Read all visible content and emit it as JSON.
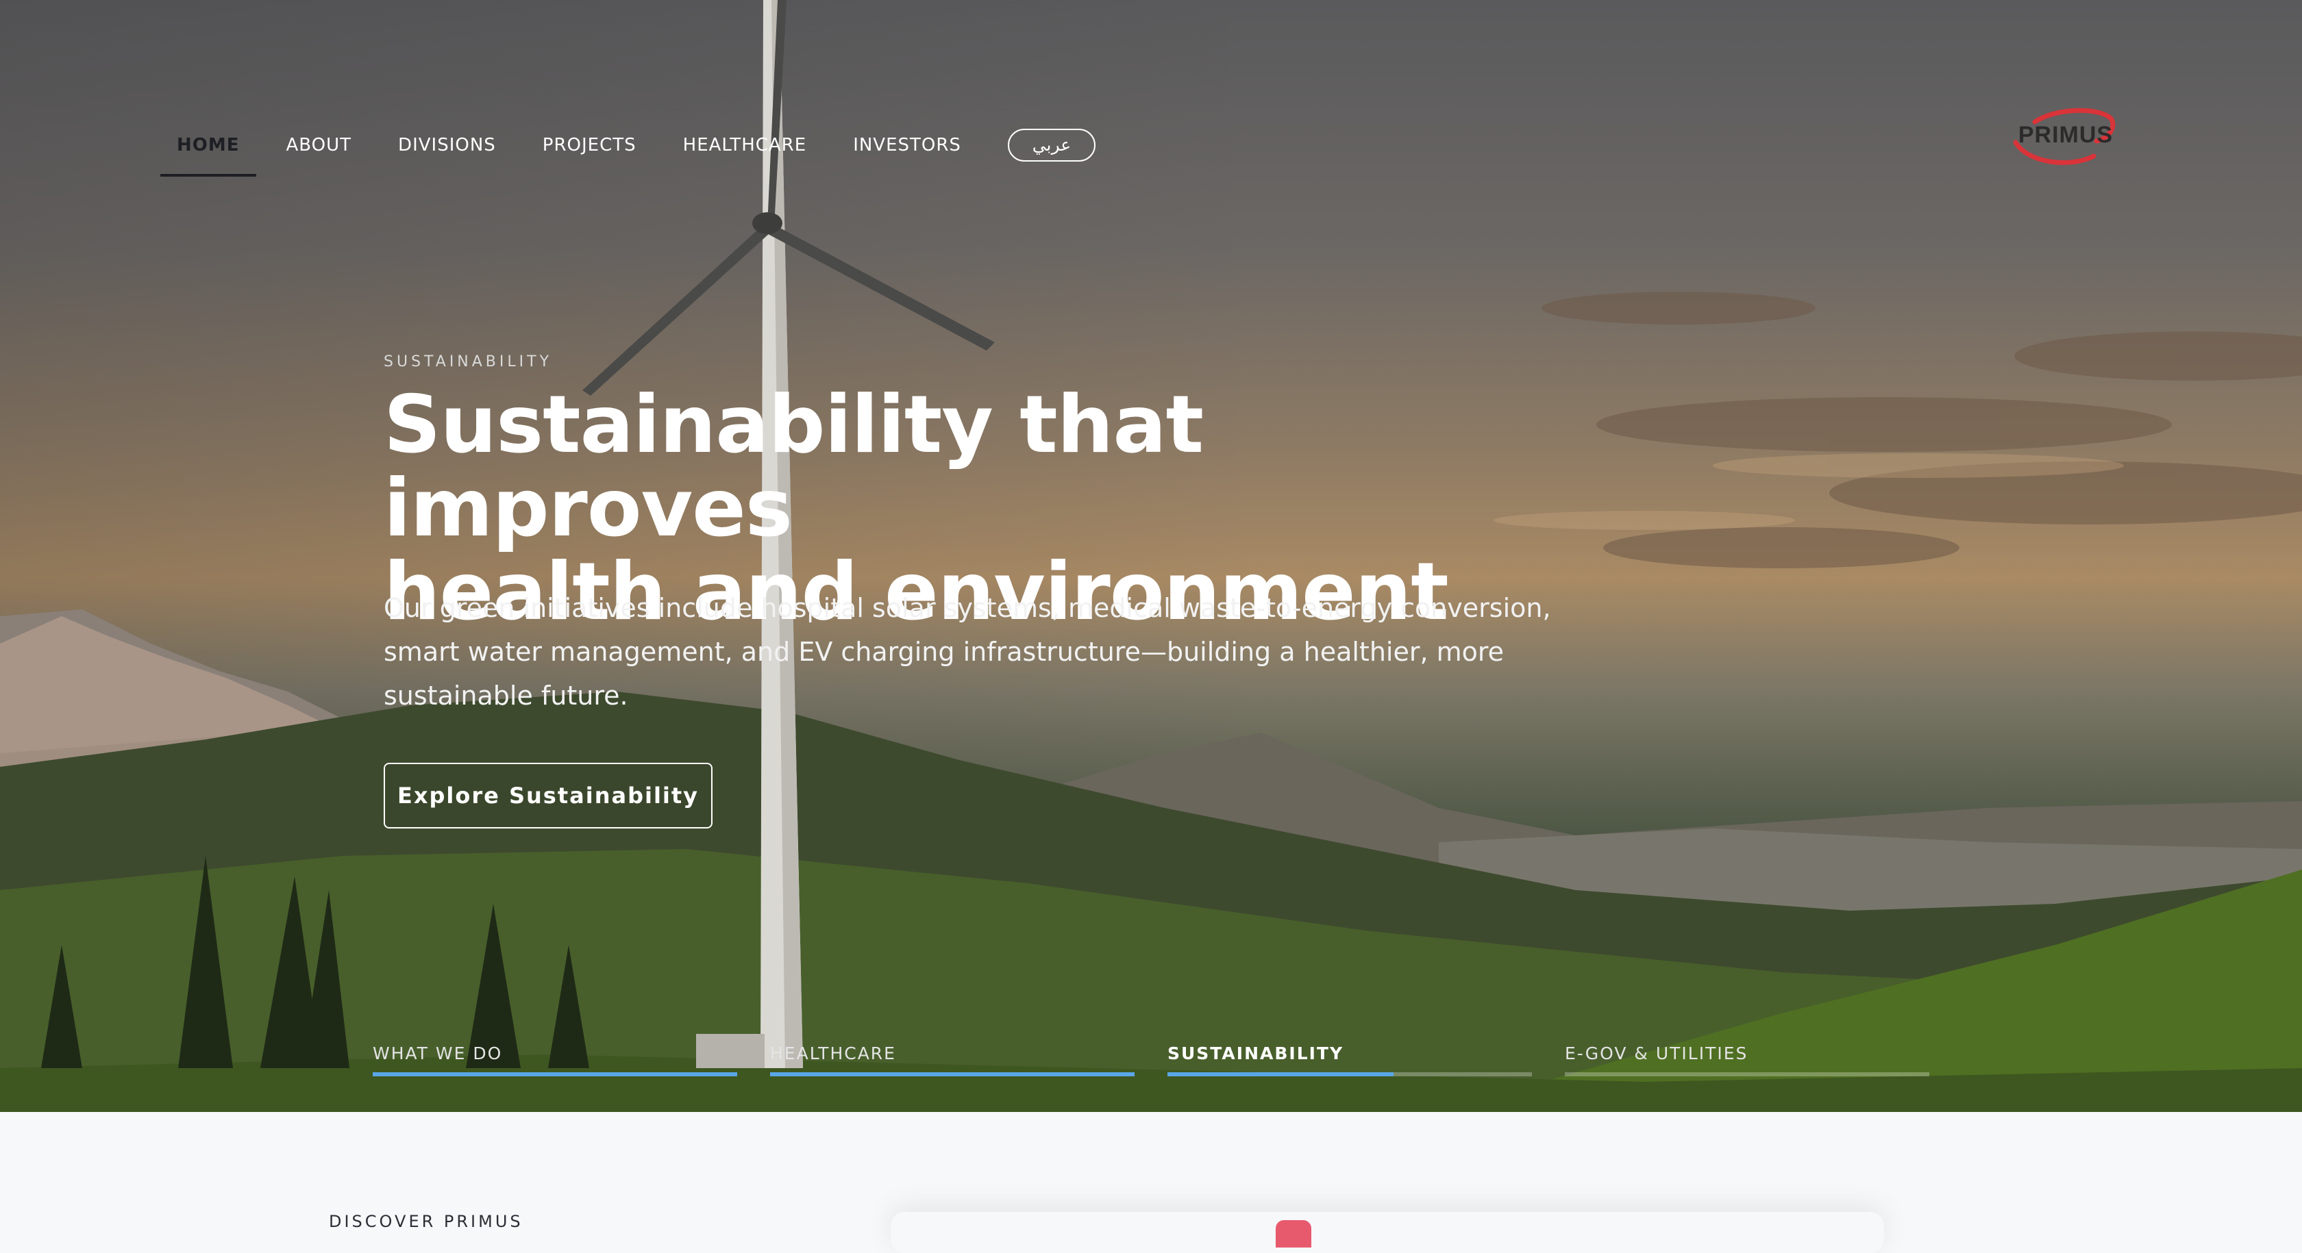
{
  "nav": {
    "items": [
      {
        "label": "HOME",
        "active": true
      },
      {
        "label": "ABOUT",
        "active": false
      },
      {
        "label": "DIVISIONS",
        "active": false
      },
      {
        "label": "PROJECTS",
        "active": false
      },
      {
        "label": "HEALTHCARE",
        "active": false
      },
      {
        "label": "INVESTORS",
        "active": false
      }
    ],
    "lang_label": "عربي"
  },
  "logo": {
    "text": "PRIMUS",
    "accent": "#d9343a",
    "text_color": "#2b2b2b"
  },
  "hero": {
    "eyebrow": "SUSTAINABILITY",
    "title_line1": "Sustainability that improves",
    "title_line2": "health and environment",
    "lead": "Our green initiatives include hospital solar systems, medical waste-to-energy conversion, smart water management, and EV charging infrastructure—building a healthier, more sustainable future.",
    "cta_label": "Explore Sustainability"
  },
  "tabs": [
    {
      "label": "WHAT WE DO",
      "progress": 1.0,
      "active": false
    },
    {
      "label": "HEALTHCARE",
      "progress": 1.0,
      "active": false
    },
    {
      "label": "SUSTAINABILITY",
      "progress": 0.62,
      "active": true
    },
    {
      "label": "E-GOV & UTILITIES",
      "progress": 0.0,
      "active": false
    }
  ],
  "section": {
    "eyebrow": "DISCOVER PRIMUS"
  },
  "colors": {
    "accent_blue": "#5aa6e6",
    "logo_red": "#d9343a",
    "cta_pink": "#e75a6e"
  }
}
